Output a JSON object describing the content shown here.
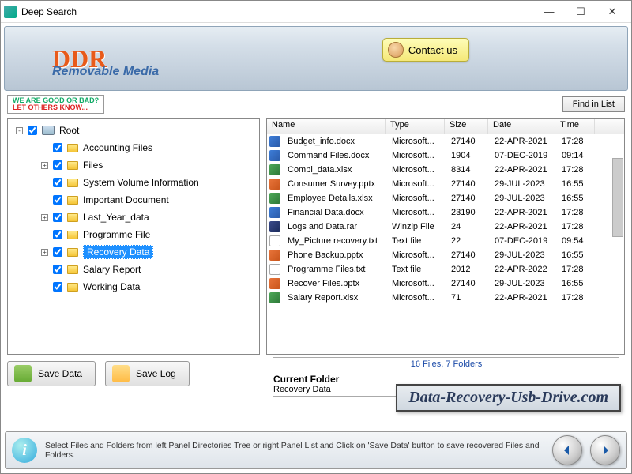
{
  "window": {
    "title": "Deep Search"
  },
  "banner": {
    "logo_top": "DDR",
    "logo_sub": "Removable Media",
    "contact": "Contact us"
  },
  "toolbar": {
    "promo_l1": "WE ARE GOOD OR BAD?",
    "promo_l2": "LET OTHERS KNOW...",
    "find": "Find in List"
  },
  "tree": {
    "root": "Root",
    "items": [
      {
        "label": "Accounting Files",
        "expand": ""
      },
      {
        "label": "Files",
        "expand": "+"
      },
      {
        "label": "System Volume Information",
        "expand": ""
      },
      {
        "label": "Important Document",
        "expand": ""
      },
      {
        "label": "Last_Year_data",
        "expand": "+"
      },
      {
        "label": "Programme File",
        "expand": ""
      },
      {
        "label": "Recovery Data",
        "expand": "+",
        "selected": true
      },
      {
        "label": "Salary Report",
        "expand": ""
      },
      {
        "label": "Working Data",
        "expand": ""
      }
    ]
  },
  "columns": {
    "name": "Name",
    "type": "Type",
    "size": "Size",
    "date": "Date",
    "time": "Time"
  },
  "files": [
    {
      "ic": "word",
      "name": "Budget_info.docx",
      "type": "Microsoft...",
      "size": "27140",
      "date": "22-APR-2021",
      "time": "17:28"
    },
    {
      "ic": "word",
      "name": "Command Files.docx",
      "type": "Microsoft...",
      "size": "1904",
      "date": "07-DEC-2019",
      "time": "09:14"
    },
    {
      "ic": "excel",
      "name": "Compl_data.xlsx",
      "type": "Microsoft...",
      "size": "8314",
      "date": "22-APR-2021",
      "time": "17:28"
    },
    {
      "ic": "ppt",
      "name": "Consumer Survey.pptx",
      "type": "Microsoft...",
      "size": "27140",
      "date": "29-JUL-2023",
      "time": "16:55"
    },
    {
      "ic": "excel",
      "name": "Employee Details.xlsx",
      "type": "Microsoft...",
      "size": "27140",
      "date": "29-JUL-2023",
      "time": "16:55"
    },
    {
      "ic": "word",
      "name": "Financial Data.docx",
      "type": "Microsoft...",
      "size": "23190",
      "date": "22-APR-2021",
      "time": "17:28"
    },
    {
      "ic": "rar",
      "name": "Logs and Data.rar",
      "type": "Winzip File",
      "size": "24",
      "date": "22-APR-2021",
      "time": "17:28"
    },
    {
      "ic": "txt",
      "name": "My_Picture recovery.txt",
      "type": "Text file",
      "size": "22",
      "date": "07-DEC-2019",
      "time": "09:54"
    },
    {
      "ic": "ppt",
      "name": "Phone Backup.pptx",
      "type": "Microsoft...",
      "size": "27140",
      "date": "29-JUL-2023",
      "time": "16:55"
    },
    {
      "ic": "txt",
      "name": "Programme Files.txt",
      "type": "Text file",
      "size": "2012",
      "date": "22-APR-2022",
      "time": "17:28"
    },
    {
      "ic": "ppt",
      "name": "Recover Files.pptx",
      "type": "Microsoft...",
      "size": "27140",
      "date": "29-JUL-2023",
      "time": "16:55"
    },
    {
      "ic": "excel",
      "name": "Salary Report.xlsx",
      "type": "Microsoft...",
      "size": "71",
      "date": "22-APR-2021",
      "time": "17:28"
    }
  ],
  "buttons": {
    "save_data": "Save Data",
    "save_log": "Save Log"
  },
  "status": {
    "summary": "16 Files, 7 Folders",
    "cf_label": "Current Folder",
    "cf_value": "Recovery Data"
  },
  "site": "Data-Recovery-Usb-Drive.com",
  "footer": {
    "text": "Select Files and Folders from left Panel Directories Tree or right Panel List and Click on 'Save Data' button to save recovered Files and Folders."
  }
}
